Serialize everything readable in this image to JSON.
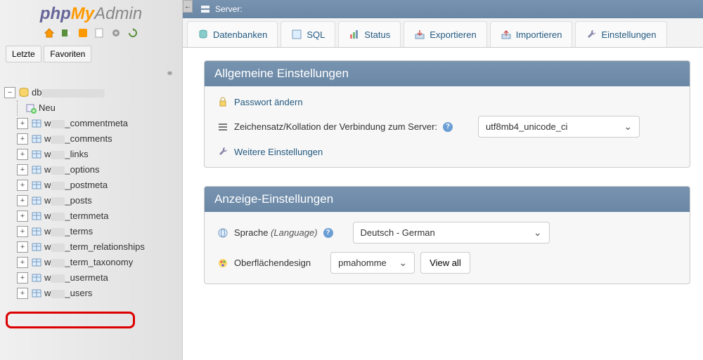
{
  "logo": {
    "p1": "php",
    "p2": "My",
    "p3": "Admin"
  },
  "sidebar_tabs": {
    "recent": "Letzte",
    "favorites": "Favoriten"
  },
  "tree": {
    "db_prefix": "db",
    "new_label": "Neu",
    "table_prefix": "w",
    "tables": [
      "_commentmeta",
      "_comments",
      "_links",
      "_options",
      "_postmeta",
      "_posts",
      "_termmeta",
      "_terms",
      "_term_relationships",
      "_term_taxonomy",
      "_usermeta",
      "_users"
    ]
  },
  "server_label": "Server:",
  "tabs": {
    "databases": "Datenbanken",
    "sql": "SQL",
    "status": "Status",
    "export": "Exportieren",
    "import": "Importieren",
    "settings": "Einstellungen"
  },
  "panel_general": {
    "title": "Allgemeine Einstellungen",
    "change_pw": "Passwort ändern",
    "collation_label": "Zeichensatz/Kollation der Verbindung zum Server:",
    "collation_value": "utf8mb4_unicode_ci",
    "more": "Weitere Einstellungen"
  },
  "panel_display": {
    "title": "Anzeige-Einstellungen",
    "language_label": "Sprache",
    "language_hint": "(Language)",
    "language_value": "Deutsch - German",
    "theme_label": "Oberflächendesign",
    "theme_value": "pmahomme",
    "view_all": "View all"
  }
}
